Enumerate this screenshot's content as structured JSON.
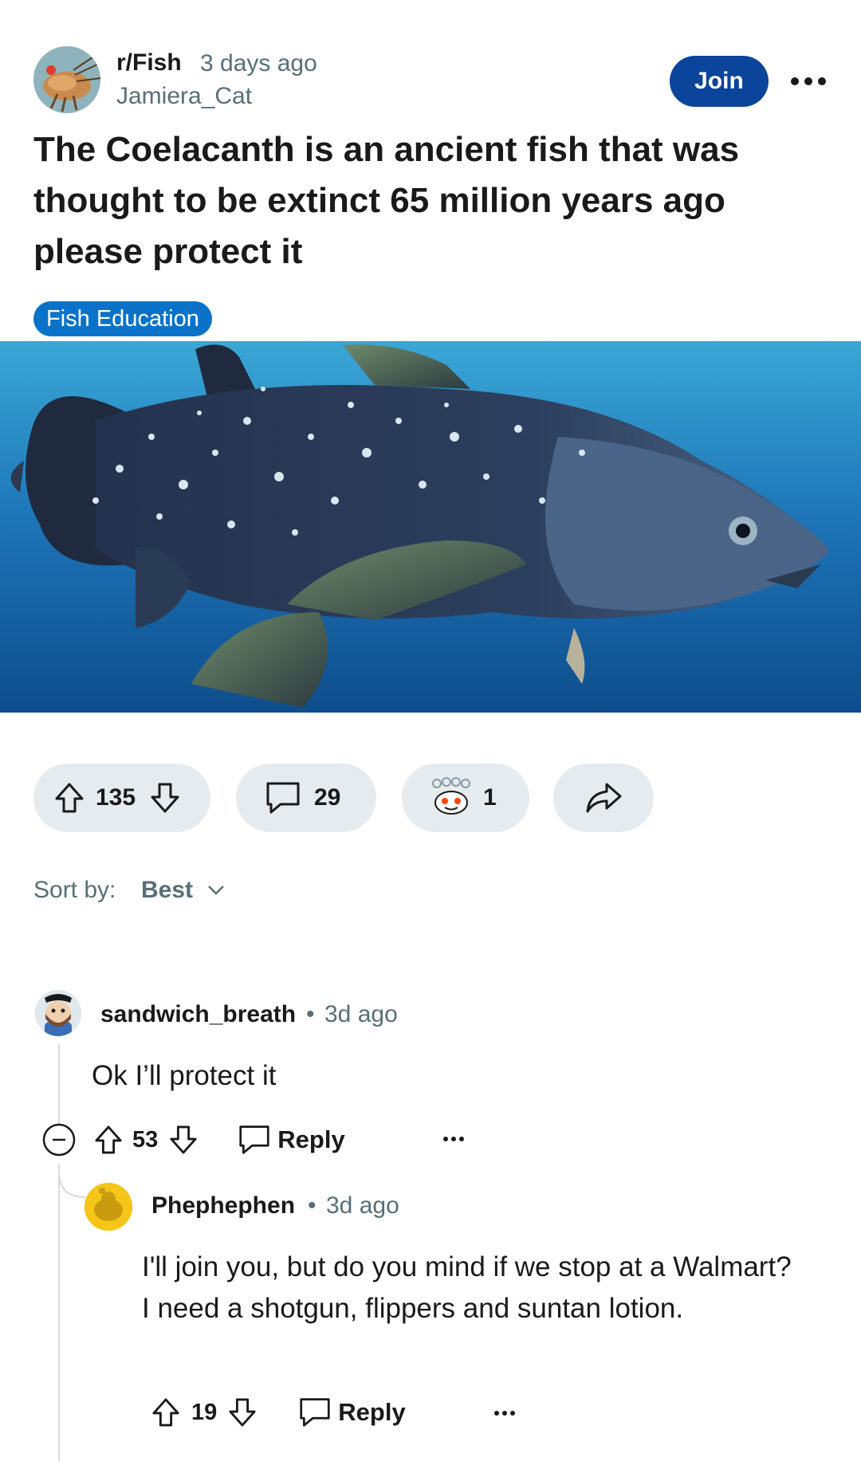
{
  "post": {
    "subreddit": "r/Fish",
    "age": "3 days ago",
    "author": "Jamiera_Cat",
    "join_label": "Join",
    "title": "The Coelacanth is an ancient fish that was thought to be extinct 65 million years ago please protect it",
    "flair": "Fish Education",
    "image_icon": "coelacanth-photo"
  },
  "actions": {
    "upvotes": "135",
    "comments": "29",
    "awards": "1",
    "share_icon": "share-icon"
  },
  "sort": {
    "label": "Sort by:",
    "value": "Best"
  },
  "comments": [
    {
      "user": "sandwich_breath",
      "separator": "•",
      "time": "3d ago",
      "body": "Ok I’ll protect it",
      "votes": "53",
      "reply_label": "Reply"
    },
    {
      "user": "Phephephen",
      "separator": "•",
      "time": "3d ago",
      "body": "I'll join you, but do you mind if we stop at a Walmart? I need a shotgun, flippers and suntan lotion.",
      "votes": "19",
      "reply_label": "Reply"
    }
  ],
  "colors": {
    "join": "#0a449b",
    "flair": "#0a73c9",
    "pill": "#e5ebee",
    "muted": "#576f76"
  }
}
